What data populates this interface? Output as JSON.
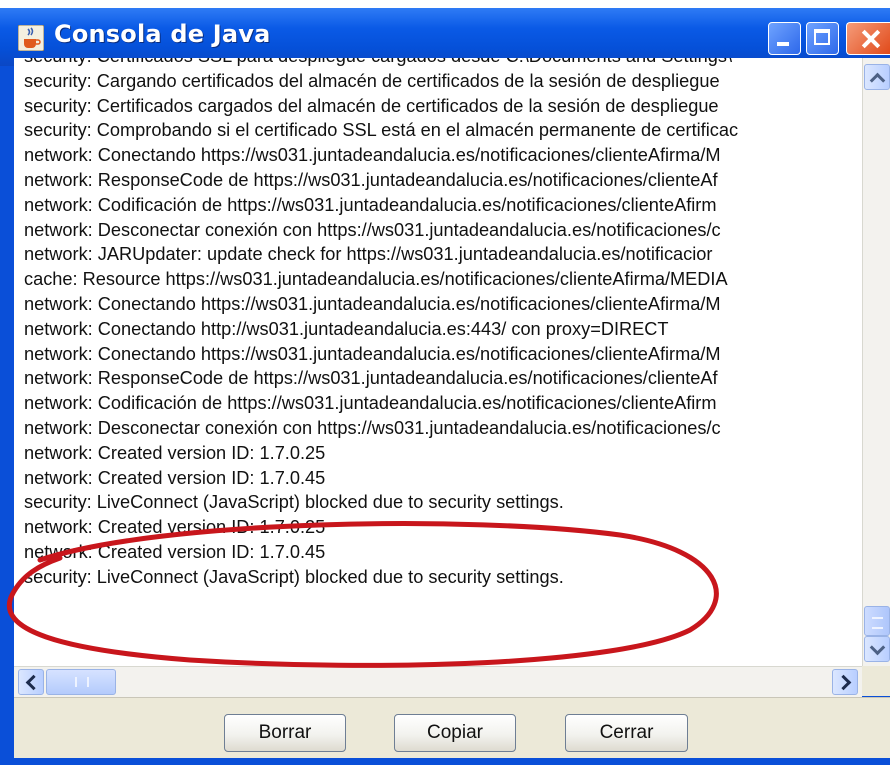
{
  "window": {
    "title": "Consola de Java"
  },
  "console_lines": [
    "security: Certificados SSL para despliegue cargados desde C:\\Documents and Settings\\",
    "security: Cargando certificados del almacén de certificados de la sesión de despliegue",
    "security: Certificados cargados del almacén de certificados de la sesión de despliegue",
    "security: Comprobando si el certificado SSL está en el almacén permanente de certificac",
    "network: Conectando https://ws031.juntadeandalucia.es/notificaciones/clienteAfirma/M",
    "network: ResponseCode de https://ws031.juntadeandalucia.es/notificaciones/clienteAf",
    "network: Codificación de https://ws031.juntadeandalucia.es/notificaciones/clienteAfirm",
    "network: Desconectar conexión con https://ws031.juntadeandalucia.es/notificaciones/c",
    "network: JARUpdater: update check for https://ws031.juntadeandalucia.es/notificacior",
    "cache: Resource https://ws031.juntadeandalucia.es/notificaciones/clienteAfirma/MEDIA",
    "network: Conectando https://ws031.juntadeandalucia.es/notificaciones/clienteAfirma/M",
    "network: Conectando http://ws031.juntadeandalucia.es:443/ con proxy=DIRECT",
    "network: Conectando https://ws031.juntadeandalucia.es/notificaciones/clienteAfirma/M",
    "network: ResponseCode de https://ws031.juntadeandalucia.es/notificaciones/clienteAf",
    "network: Codificación de https://ws031.juntadeandalucia.es/notificaciones/clienteAfirm",
    "network: Desconectar conexión con https://ws031.juntadeandalucia.es/notificaciones/c",
    "network: Created version ID: 1.7.0.25",
    "network: Created version ID: 1.7.0.45",
    "security: LiveConnect (JavaScript) blocked due to security settings.",
    "network: Created version ID: 1.7.0.25",
    "network: Created version ID: 1.7.0.45",
    "security: LiveConnect (JavaScript) blocked due to security settings."
  ],
  "buttons": {
    "clear": "Borrar",
    "copy": "Copiar",
    "close": "Cerrar"
  },
  "icons": {
    "app": "java-cup-icon",
    "minimize": "minimize-icon",
    "maximize": "maximize-icon",
    "close": "close-icon"
  },
  "colors": {
    "titlebar": "#0550d8",
    "annotation": "#c8161c",
    "panel": "#ece9d8"
  }
}
